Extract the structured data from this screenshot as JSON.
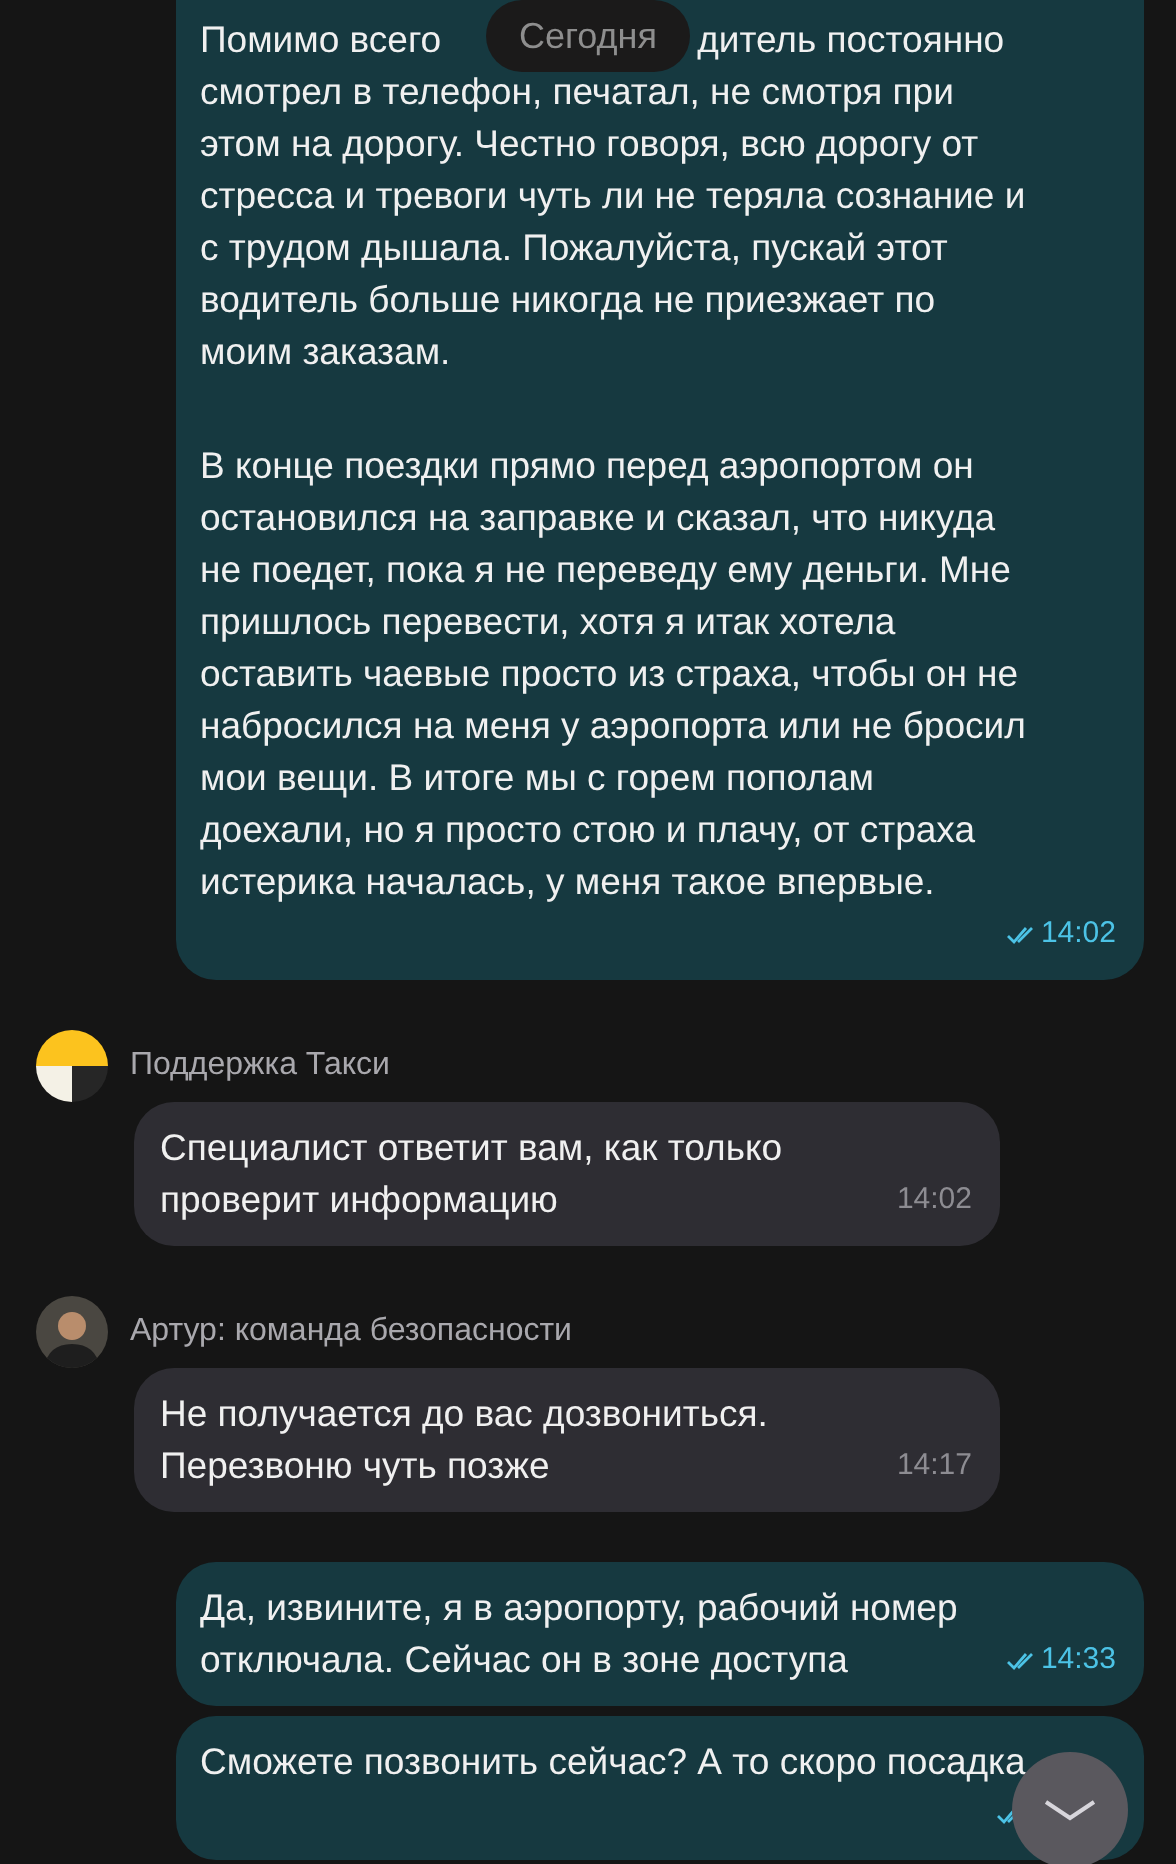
{
  "date_label": "Сегодня",
  "messages": [
    {
      "kind": "outgoing",
      "covered_line": [
        "Помимо всего",
        "дитель постоянно"
      ],
      "paragraphs": [
        "смотрел в телефон, печатал, не смотря при\nэтом на дорогу. Честно говоря, всю дорогу от\nстресса и тревоги чуть ли не теряла сознание и\nс трудом дышала. Пожалуйста, пускай этот\nводитель больше никогда не приезжает по\nмоим заказам.",
        "В конце поездки прямо перед аэропортом он\nостановился на заправке и сказал, что никуда\nне поедет, пока я не переведу ему деньги. Мне\nпришлось перевести, хотя я итак хотела\nоставить чаевые просто из страха, чтобы он не\nнабросился на меня у аэропорта или не бросил\nмои вещи. В итоге мы с горем пополам\nдоехали, но я просто стою и плачу, от страха\nистерика началась, у меня такое впервые."
      ],
      "time": "14:02",
      "read": true
    },
    {
      "kind": "incoming",
      "sender": "Поддержка Такси",
      "avatar": {
        "kind": "logo"
      },
      "paragraphs": [
        "Специалист ответит вам, как только\nпроверит информацию"
      ],
      "time": "14:02"
    },
    {
      "kind": "incoming",
      "sender": "Артур: команда безопасности",
      "avatar": {
        "kind": "person"
      },
      "paragraphs": [
        "Не получается до вас дозвониться.\nПерезвоню чуть позже"
      ],
      "time": "14:17"
    },
    {
      "kind": "outgoing",
      "paragraphs": [
        "Да, извините, я в аэропорту, рабочий номер\nотключала. Сейчас он в зоне доступа"
      ],
      "time": "14:33",
      "read": true
    },
    {
      "kind": "outgoing",
      "paragraphs": [
        "Сможете позвонить сейчас? А то скоро посадка"
      ],
      "read": true
    }
  ]
}
